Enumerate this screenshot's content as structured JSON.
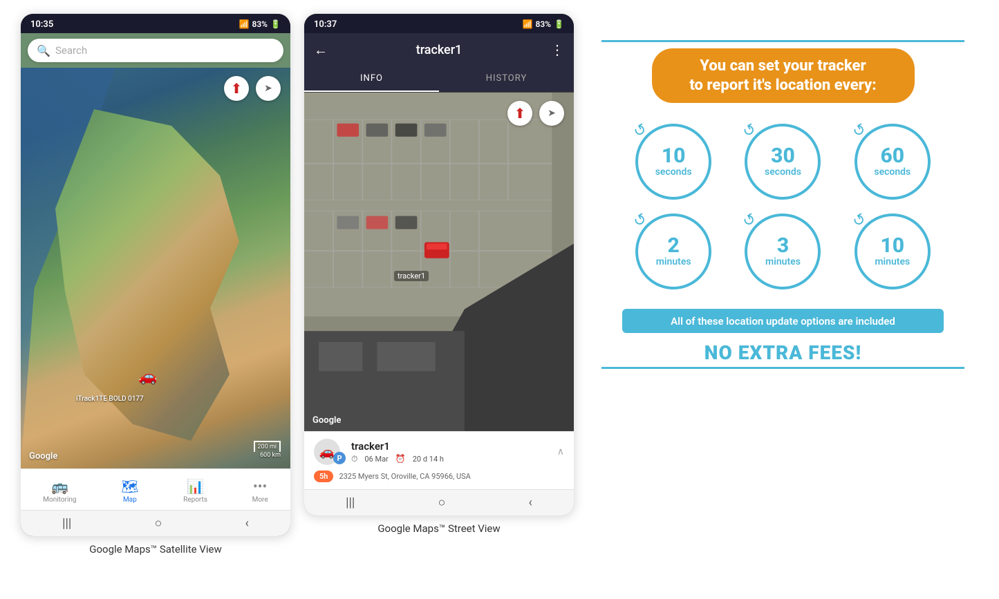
{
  "phone1": {
    "status_time": "10:35",
    "status_signal": "▲▲▲",
    "status_battery": "83%",
    "search_placeholder": "Search",
    "map_label": "iTrack1TE BOLD 0177",
    "map_scale": "200 mi\n600 km",
    "google_logo": "Google",
    "nav_items": [
      {
        "label": "Monitoring",
        "icon": "🚌",
        "active": false
      },
      {
        "label": "Map",
        "icon": "📍",
        "active": true
      },
      {
        "label": "Reports",
        "icon": "▦",
        "active": false
      },
      {
        "label": "More",
        "icon": "•••",
        "active": false
      }
    ],
    "caption": "Google Maps™ Satellite View"
  },
  "phone2": {
    "status_time": "10:37",
    "status_signal": "▲▲▲",
    "status_battery": "83%",
    "header_title": "tracker1",
    "tab_info": "INFO",
    "tab_history": "HISTORY",
    "tracker_name": "tracker1",
    "tracker_date": "06 Mar",
    "tracker_duration": "20 d 14 h",
    "tracker_address": "2325 Myers St, Oroville, CA 95966, USA",
    "tracker_time_badge": "5h",
    "map_label": "tracker1",
    "google_logo": "Google",
    "caption": "Google Maps™ Street View"
  },
  "infographic": {
    "headline_line1": "You can set your tracker",
    "headline_line2": "to report it's location every:",
    "circles": [
      {
        "number": "10",
        "unit": "seconds"
      },
      {
        "number": "30",
        "unit": "seconds"
      },
      {
        "number": "60",
        "unit": "seconds"
      },
      {
        "number": "2",
        "unit": "minutes"
      },
      {
        "number": "3",
        "unit": "minutes"
      },
      {
        "number": "10",
        "unit": "minutes"
      }
    ],
    "included_text": "All of these location update options are included",
    "no_fees_text": "NO EXTRA FEES!"
  }
}
